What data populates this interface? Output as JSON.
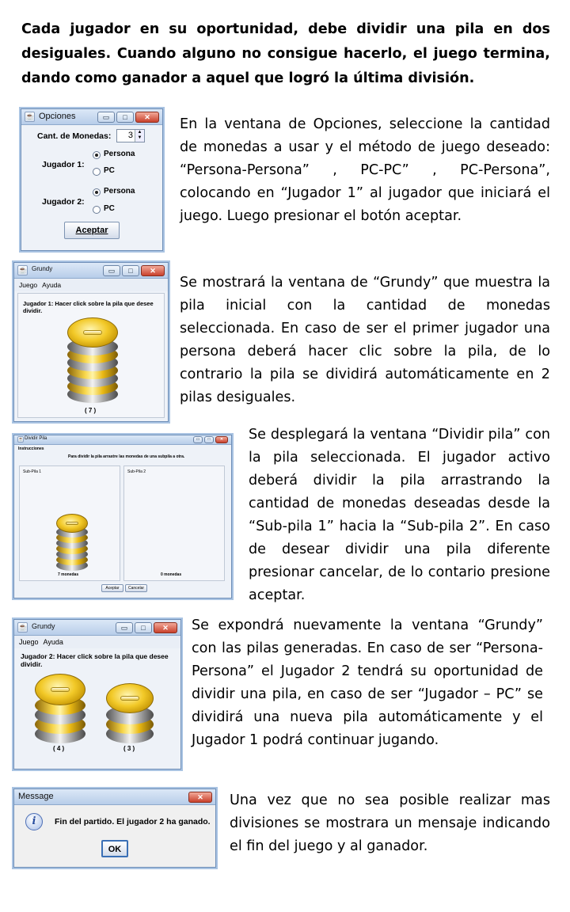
{
  "intro": "Cada jugador en su oportunidad, debe dividir una pila en dos desiguales. Cuando alguno no consigue hacerlo, el juego termina, dando como ganador a aquel que logró la última división.",
  "paragraphs": [
    "En la ventana de Opciones, seleccione la cantidad de monedas a usar y el método de juego deseado: “Persona-Persona” , PC-PC” , PC-Persona”,  colocando en “Jugador 1” al jugador que iniciará el juego. Luego presionar el botón aceptar.",
    "Se mostrará la ventana  de “Grundy” que muestra la pila inicial con la cantidad de monedas seleccionada. En caso de  ser el primer jugador una persona deberá hacer clic sobre la pila, de lo contrario la pila se dividirá automáticamente en 2 pilas desiguales.",
    "Se desplegará la ventana  “Dividir pila” con la pila seleccionada. El jugador activo deberá dividir la pila arrastrando la cantidad de monedas deseadas desde la “Sub-pila 1” hacia la “Sub-pila 2”. En caso de  desear dividir una pila diferente presionar cancelar, de lo contario presione aceptar.",
    "Se expondrá nuevamente la ventana “Grundy” con las pilas generadas. En caso de ser “Persona-Persona” el Jugador 2 tendrá su oportunidad de dividir una pila, en caso de ser “Jugador – PC” se dividirá una nueva pila automáticamente y el Jugador 1 podrá continuar jugando.",
    "Una vez que no sea posible realizar mas divisiones se mostrara un mensaje indicando el fin del juego y al ganador."
  ],
  "options_window": {
    "title": "Opciones",
    "coins_label": "Cant. de Monedas:",
    "coins_value": "3",
    "player1_label": "Jugador 1:",
    "player2_label": "Jugador 2:",
    "option_person": "Persona",
    "option_pc": "PC",
    "accept": "Aceptar"
  },
  "grundy_window_1": {
    "title": "Grundy",
    "menu": [
      "Juego",
      "Ayuda"
    ],
    "instruction": "Jugador 1: Hacer click sobre la pila que desee dividir.",
    "counts": [
      "( 7 )"
    ]
  },
  "divide_window": {
    "title": "Dividir Pila",
    "section": "Instrucciones",
    "instruction": "Para dividir la pila arrastre las monedas de una subpila a otra.",
    "sub1": "Sub-Pila 1",
    "sub2": "Sub-Pila 2",
    "sub1_count": "7 monedas",
    "sub2_count": "0 monedas",
    "accept": "Aceptar",
    "cancel": "Cancelar"
  },
  "grundy_window_2": {
    "title": "Grundy",
    "menu": [
      "Juego",
      "Ayuda"
    ],
    "instruction": "Jugador 2: Hacer click sobre la pila que desee dividir.",
    "counts": [
      "( 4 )",
      "( 3 )"
    ]
  },
  "message_window": {
    "title": "Message",
    "text": "Fin del partido. El jugador 2 ha ganado.",
    "ok": "OK"
  },
  "icons": {
    "java": "java-cup-icon",
    "info": "info-icon"
  }
}
